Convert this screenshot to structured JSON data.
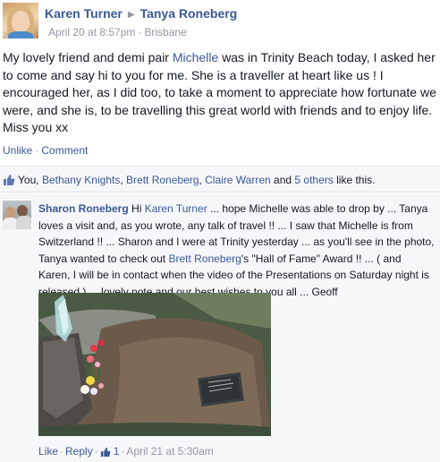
{
  "header": {
    "author": "Karen Turner",
    "target": "Tanya Roneberg",
    "date": "April 20 at 8:57pm",
    "location": "Brisbane",
    "separator": "·"
  },
  "post": {
    "text_parts": [
      "My lovely friend and demi pair ",
      "Michelle",
      " was in Trinity Beach today, I asked her to come and say hi to you for me. She is a traveller at heart like us ! I encouraged her, as I did too, to take a moment to appreciate how fortunate we were, and she is, to be travelling this great world with friends and to enjoy life. Miss you xx"
    ],
    "actions": {
      "unlike": "Unlike",
      "comment": "Comment",
      "separator": "·"
    }
  },
  "likes": {
    "you": "You,",
    "names": [
      "Bethany Knights",
      "Brett Roneberg",
      "Claire Warren"
    ],
    "and": "and",
    "others": "5 others",
    "suffix": "like this.",
    "comma": ","
  },
  "comment": {
    "author": "Sharon Roneberg",
    "parts": [
      " Hi ",
      "Karen Turner",
      " ... hope Michelle was able to drop by ... Tanya loves a visit and, as you wrote, any talk of travel !! ... I saw that Michelle is from Switzerland !! ... Sharon and I were at Trinity yesterday ... as you'll see in the photo, Tanya wanted to check out ",
      "Brett Roneberg",
      "'s \"Hall of Fame\" Award !! ... ( and Karen, I will be in contact when the video of the Presentations on Saturday night is released ) ... lovely note and our best wishes to you all ... Geoff"
    ],
    "actions": {
      "like": "Like",
      "reply": "Reply",
      "like_count": "1",
      "time": "April 21 at 5:30am",
      "separator": "·"
    }
  },
  "colors": {
    "link": "#3b5998",
    "muted": "#9197a3",
    "bar_bg": "#f6f7f9"
  }
}
